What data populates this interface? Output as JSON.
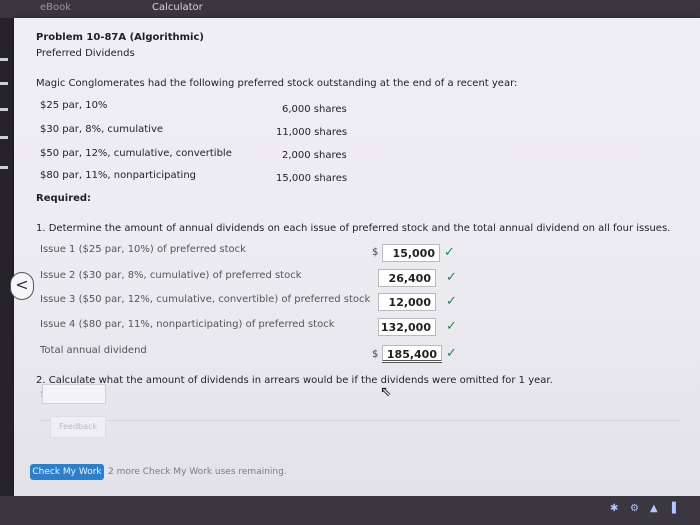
{
  "top_tabs": {
    "ebook": "eBook",
    "calculator": "Calculator"
  },
  "problem": {
    "title": "Problem 10-87A (Algorithmic)",
    "subtitle": "Preferred Dividends",
    "intro": "Magic Conglomerates had the following preferred stock outstanding at the end of a recent year:",
    "stocks": [
      {
        "desc": "$25 par, 10%",
        "shares": "6,000 shares"
      },
      {
        "desc": "$30 par, 8%, cumulative",
        "shares": "11,000 shares"
      },
      {
        "desc": "$50 par, 12%, cumulative, convertible",
        "shares": "2,000 shares"
      },
      {
        "desc": "$80 par, 11%, nonparticipating",
        "shares": "15,000 shares"
      }
    ],
    "required_label": "Required:",
    "q1": "1. Determine the amount of annual dividends on each issue of preferred stock and the total annual dividend on all four issues.",
    "issues": [
      {
        "label": "Issue 1 ($25 par, 10%) of preferred stock",
        "value": "15,000"
      },
      {
        "label": "Issue 2 ($30 par, 8%, cumulative) of preferred stock",
        "value": "26,400"
      },
      {
        "label": "Issue 3 ($50 par, 12%, cumulative, convertible) of preferred stock",
        "value": "12,000"
      },
      {
        "label": "Issue 4 ($80 par, 11%, nonparticipating) of preferred stock",
        "value": "132,000"
      }
    ],
    "total": {
      "label": "Total annual dividend",
      "value": "185,400"
    },
    "dollar_sign": "$",
    "check_mark": "✓",
    "q2": "2. Calculate what the amount of dividends in arrears would be if the dividends were omitted for 1 year."
  },
  "buttons": {
    "feedback": "Feedback",
    "check_my_work": "Check My Work",
    "prev": "<"
  },
  "status": {
    "remaining": "2 more Check My Work uses remaining."
  }
}
